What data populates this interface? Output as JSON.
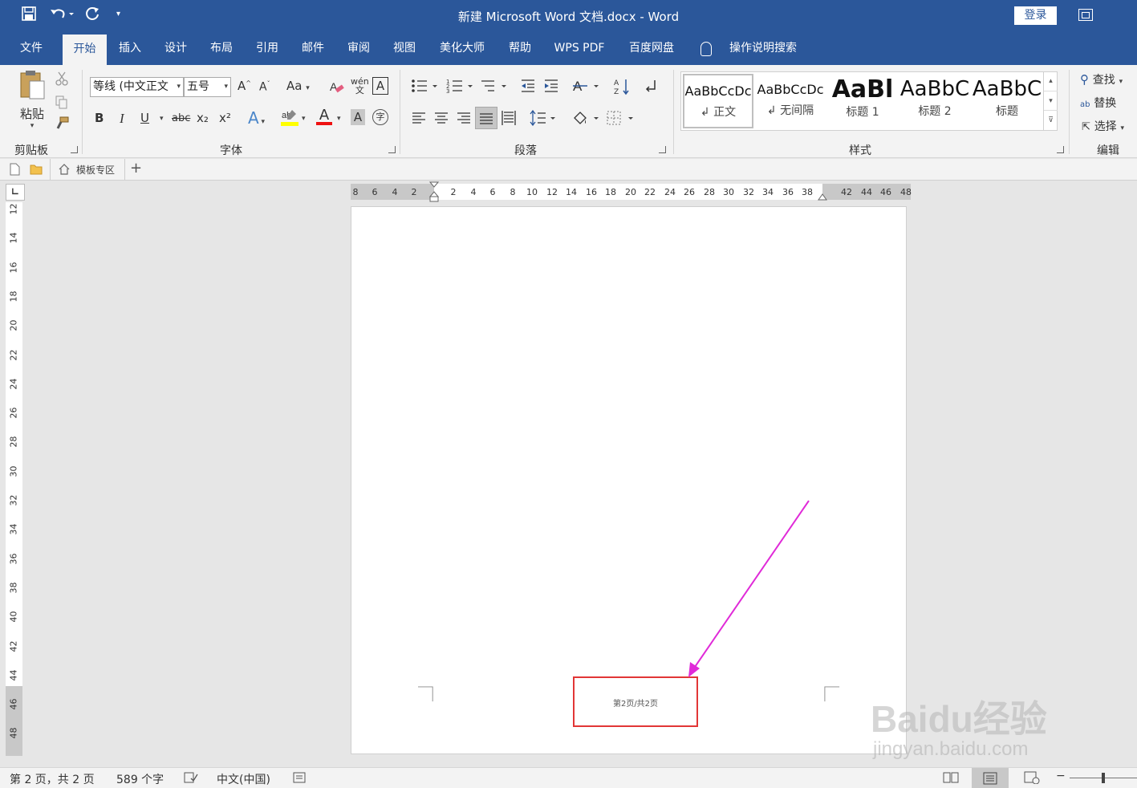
{
  "titlebar": {
    "title": "新建 Microsoft Word 文档.docx  -  Word",
    "login_label": "登录",
    "quick_access": [
      "save-icon",
      "undo-icon",
      "redo-icon",
      "customize-icon"
    ]
  },
  "menu": {
    "tabs": [
      "文件",
      "开始",
      "插入",
      "设计",
      "布局",
      "引用",
      "邮件",
      "审阅",
      "视图",
      "美化大师",
      "帮助",
      "WPS PDF",
      "百度网盘"
    ],
    "active_tab": "开始",
    "search_label": "操作说明搜索"
  },
  "ribbon": {
    "clipboard": {
      "paste_label": "粘贴",
      "group_label": "剪贴板"
    },
    "font": {
      "font_name": "等线 (中文正文",
      "font_size": "五号",
      "group_label": "字体",
      "buttons": {
        "bold": "B",
        "italic": "I",
        "underline": "U",
        "strike": "abc",
        "sub": "x₂",
        "sup": "x²",
        "change_case": "Aa",
        "phonetic": "wén",
        "char_border": "A",
        "font_color": "A",
        "char_shading": "A",
        "enclose": "字"
      }
    },
    "paragraph": {
      "group_label": "段落"
    },
    "styles": {
      "group_label": "样式",
      "items": [
        {
          "sample": "AaBbCcDc",
          "name": "↲ 正文"
        },
        {
          "sample": "AaBbCcDc",
          "name": "↲ 无间隔"
        },
        {
          "sample": "AaBl",
          "name": "标题 1"
        },
        {
          "sample": "AaBbC",
          "name": "标题 2"
        },
        {
          "sample": "AaBbC",
          "name": "标题"
        }
      ]
    },
    "editing": {
      "find_label": "查找",
      "replace_label": "替换",
      "select_label": "选择",
      "group_label": "编辑"
    }
  },
  "doctabs": {
    "template_tab": "模板专区",
    "new_tab": "+"
  },
  "hruler": {
    "numbers": [
      "8",
      "6",
      "4",
      "2",
      "2",
      "4",
      "6",
      "8",
      "10",
      "12",
      "14",
      "16",
      "18",
      "20",
      "22",
      "24",
      "26",
      "28",
      "30",
      "32",
      "34",
      "36",
      "38",
      "42",
      "44",
      "46",
      "48"
    ]
  },
  "vruler": {
    "numbers": [
      "12",
      "14",
      "16",
      "18",
      "20",
      "22",
      "24",
      "26",
      "28",
      "30",
      "32",
      "34",
      "36",
      "38",
      "40",
      "42",
      "44",
      "46",
      "48"
    ]
  },
  "document": {
    "footer_text": "第2页/共2页"
  },
  "statusbar": {
    "page_info": "第 2 页，共 2 页",
    "word_count": "589 个字",
    "language": "中文(中国)"
  },
  "watermark": {
    "logo": "Baidu经验",
    "url": "jingyan.baidu.com"
  },
  "colors": {
    "brand": "#2b579a",
    "annotation_arrow": "#e02ad8",
    "annotation_box": "#e23636"
  }
}
